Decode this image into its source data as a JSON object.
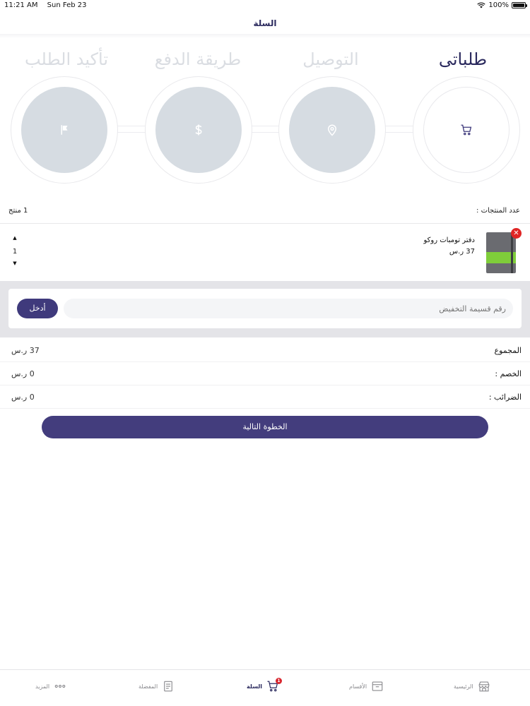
{
  "status_bar": {
    "time": "11:21 AM",
    "date": "Sun Feb 23",
    "battery": "100%",
    "battery_level": 1.0
  },
  "header": {
    "title": "السلة"
  },
  "steps": [
    {
      "label": "طلباتى",
      "icon": "cart-icon",
      "active": true
    },
    {
      "label": "التوصيل",
      "icon": "location-pin-icon",
      "active": false
    },
    {
      "label": "طريقة الدفع",
      "icon": "dollar-icon",
      "active": false
    },
    {
      "label": "تأكيد الطلب",
      "icon": "flag-icon",
      "active": false
    }
  ],
  "cart": {
    "count_label": "عدد المنتجات :",
    "count_value": "1 منتج",
    "items": [
      {
        "name": "دفتر تومبات روكو",
        "price": "37 ر.س",
        "quantity": "1"
      }
    ]
  },
  "coupon": {
    "placeholder": "رقم قسيمة التخفيض",
    "button_label": "أدخل"
  },
  "summary": {
    "subtotal_label": "المجموع",
    "subtotal_value": "37 ر.س",
    "discount_label": "الخصم :",
    "discount_value": "0 ر.س",
    "tax_label": "الضرائب :",
    "tax_value": "0 ر.س"
  },
  "next_button": "الخطوة التالية",
  "tabs": [
    {
      "label": "الرئيسية",
      "icon": "store-icon"
    },
    {
      "label": "الأقسام",
      "icon": "box-icon"
    },
    {
      "label": "السلة",
      "icon": "cart-icon",
      "badge": "1",
      "active": true
    },
    {
      "label": "المفضلة",
      "icon": "document-icon"
    },
    {
      "label": "المزيد",
      "icon": "more-dots-icon"
    }
  ],
  "colors": {
    "primary": "#433d7d",
    "title": "#2b2a5e",
    "inactive_step": "#d6dce2",
    "danger": "#e02525"
  }
}
